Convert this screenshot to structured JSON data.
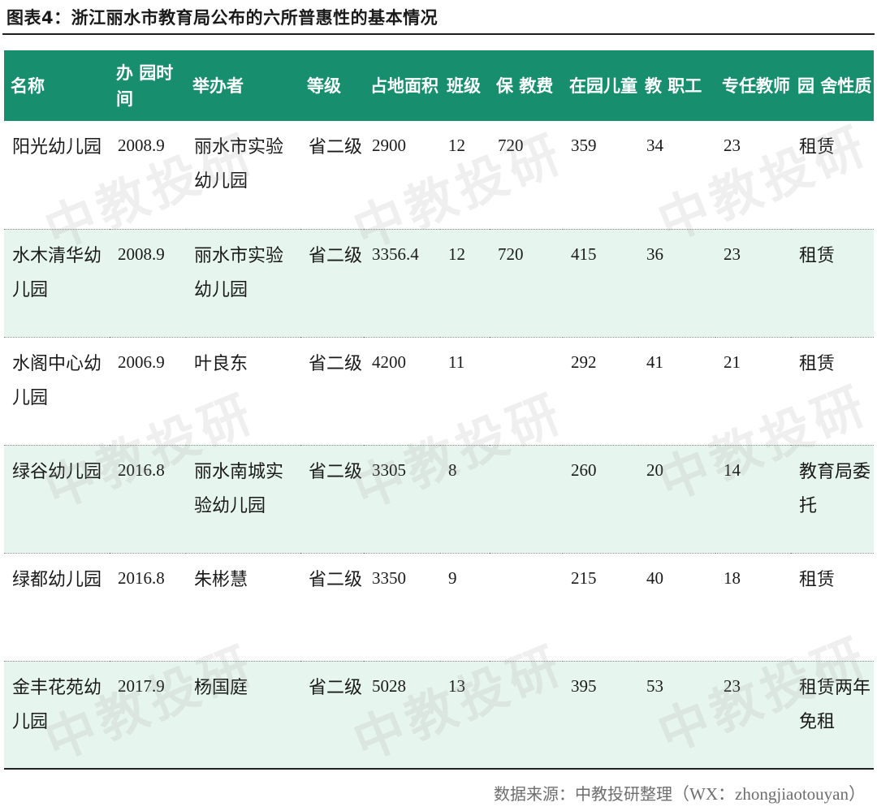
{
  "title": "图表4：浙江丽水市教育局公布的六所普惠性的基本情况",
  "columns": [
    {
      "label": "名称"
    },
    {
      "label": "办 园时间"
    },
    {
      "label": "举办者"
    },
    {
      "label": "等级"
    },
    {
      "label": "占地面积"
    },
    {
      "label": "班级"
    },
    {
      "label": "保 教费"
    },
    {
      "label": "在园儿童"
    },
    {
      "label": "教 职工"
    },
    {
      "label": "专任教师"
    },
    {
      "label": "园 舍性质"
    }
  ],
  "rows": [
    {
      "name": "阳光幼儿园",
      "time": "2008.9",
      "organizer": "丽水市实验幼儿园",
      "level": "省二级",
      "area": "2900",
      "classes": "12",
      "fee": "720",
      "children": "359",
      "staff": "34",
      "teachers": "23",
      "property": "租赁"
    },
    {
      "name": "水木清华幼儿园",
      "time": "2008.9",
      "organizer": "丽水市实验幼儿园",
      "level": "省二级",
      "area": "3356.4",
      "classes": "12",
      "fee": "720",
      "children": "415",
      "staff": "36",
      "teachers": "23",
      "property": "租赁"
    },
    {
      "name": "水阁中心幼儿园",
      "time": "2006.9",
      "organizer": "叶良东",
      "level": "省二级",
      "area": "4200",
      "classes": "11",
      "fee": "",
      "children": "292",
      "staff": "41",
      "teachers": "21",
      "property": "租赁"
    },
    {
      "name": "绿谷幼儿园",
      "time": "2016.8",
      "organizer": "丽水南城实验幼儿园",
      "level": "省二级",
      "area": "3305",
      "classes": "8",
      "fee": "",
      "children": "260",
      "staff": "20",
      "teachers": "14",
      "property": "教育局委托"
    },
    {
      "name": "绿都幼儿园",
      "time": "2016.8",
      "organizer": "朱彬慧",
      "level": "省二级",
      "area": "3350",
      "classes": "9",
      "fee": "",
      "children": "215",
      "staff": "40",
      "teachers": "18",
      "property": "租赁"
    },
    {
      "name": "金丰花苑幼儿园",
      "time": "2017.9",
      "organizer": "杨国庭",
      "level": "省二级",
      "area": "5028",
      "classes": "13",
      "fee": "",
      "children": "395",
      "staff": "53",
      "teachers": "23",
      "property": "租赁两年免租"
    }
  ],
  "source": {
    "prefix": "数据来源：中教投研整理",
    "suffix": "（WX：zhongjiaotouyan）"
  },
  "watermark_text": "中教投研"
}
